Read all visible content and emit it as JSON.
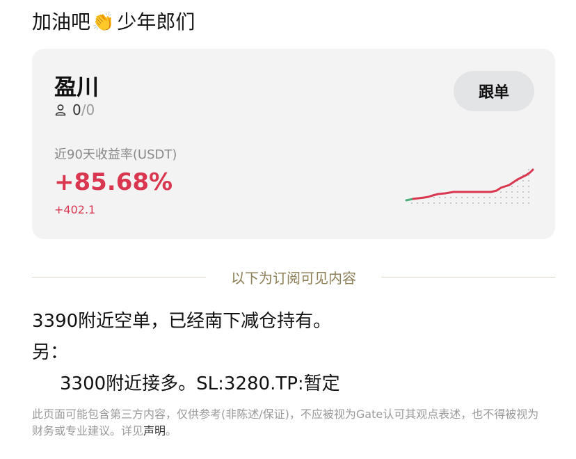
{
  "header": {
    "title_prefix": "加油吧",
    "emoji": "👏",
    "title_suffix": "少年郎们"
  },
  "card": {
    "trader_name": "盈川",
    "followers_current": "0",
    "followers_separator": "/",
    "followers_max": "0",
    "follow_button": "跟单",
    "roi_label": "近90天收益率(USDT)",
    "roi_value": "+85.68%",
    "pnl_value": "+402.1",
    "colors": {
      "profit": "#d9374f",
      "start_segment": "#4caf7a"
    }
  },
  "divider": {
    "text": "以下为订阅可见内容"
  },
  "post": {
    "line1": "3390附近空单，已经南下减仓持有。",
    "line2": "另：",
    "line3": "3300附近接多。SL:3280.TP:暂定"
  },
  "disclaimer": {
    "text": "此页面可能包含第三方内容，仅供参考(非陈述/保证)，不应被视为Gate认可其观点表述，也不得被视为财务或专业建议。详见",
    "link": "声明",
    "end": "。"
  }
}
